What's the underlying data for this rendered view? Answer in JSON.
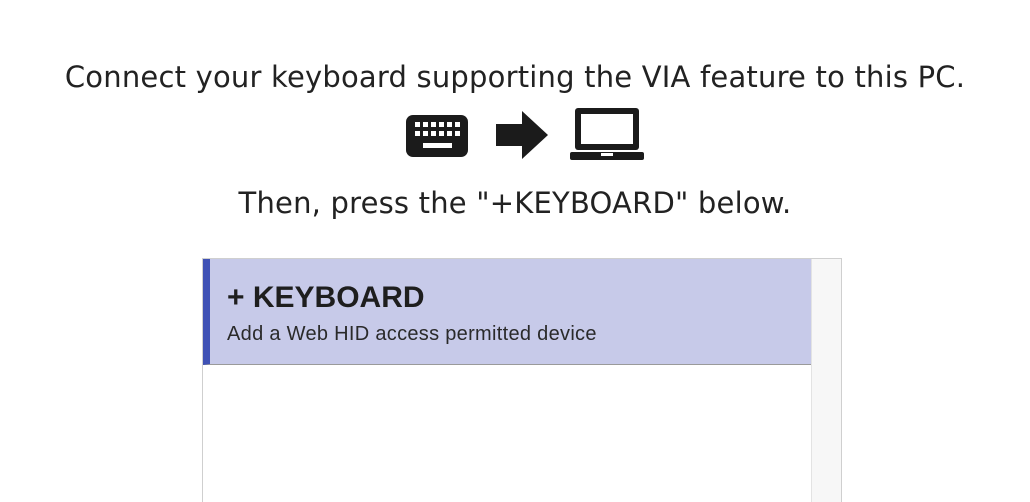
{
  "instructions": {
    "connect": "Connect your keyboard supporting the VIA feature to this PC.",
    "press": "Then, press the \"+KEYBOARD\" below."
  },
  "icons": {
    "keyboard": "keyboard-icon",
    "arrow": "arrow-right-icon",
    "laptop": "laptop-icon"
  },
  "device_list": {
    "add_keyboard": {
      "title": "+ KEYBOARD",
      "subtitle": "Add a Web HID access permitted device"
    }
  },
  "colors": {
    "text": "#222222",
    "icon": "#1b1b1b",
    "add_keyboard_bg": "#c7cae9",
    "accent": "#3f51b5",
    "list_border": "#cfcfcf"
  }
}
